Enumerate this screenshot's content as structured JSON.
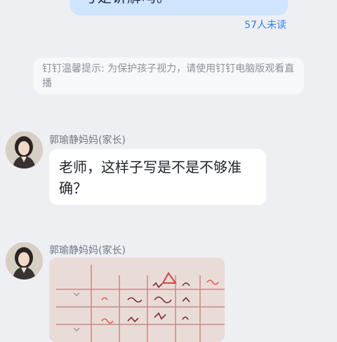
{
  "own_message": {
    "text": "号是讲解吗。",
    "read_status": "57人未读"
  },
  "system_tip": {
    "text": "钉钉温馨提示: 为保护孩子视力，请使用钉钉电脑版观看直播"
  },
  "messages": [
    {
      "sender": "郭瑜静妈妈(家长)",
      "text": "老师，这样子写是不是不够准确？"
    },
    {
      "sender": "郭瑜静妈妈(家长)",
      "type": "image"
    }
  ],
  "colors": {
    "background": "#edeff3",
    "own_bubble": "#cfe4fd",
    "read_status": "#2f7ff5",
    "tip_text": "#8b929b"
  }
}
